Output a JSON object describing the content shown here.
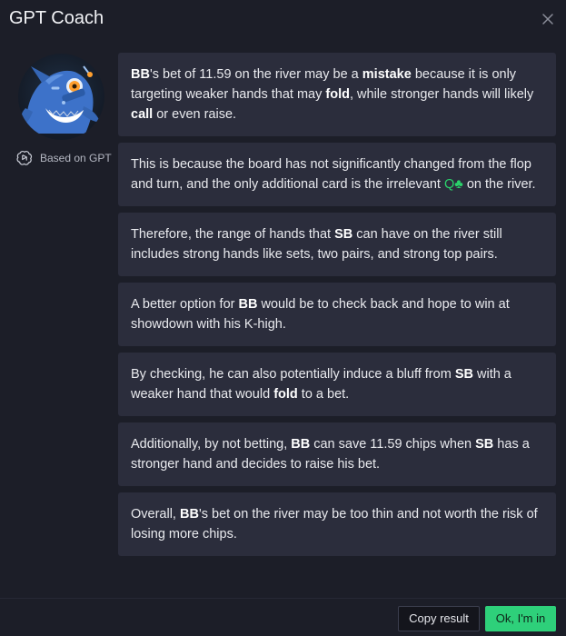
{
  "dialog": {
    "title": "GPT Coach",
    "close_icon": "close-icon"
  },
  "sidebar": {
    "avatar_icon": "shark-robot-avatar",
    "based_on_label": "Based on GPT",
    "gpt_icon": "openai-logo-icon"
  },
  "messages": [
    {
      "parts": [
        {
          "t": "BB",
          "b": true
        },
        {
          "t": "'s bet of 11.59 on the river may be a "
        },
        {
          "t": "mistake",
          "b": true
        },
        {
          "t": " because it is only targeting weaker hands that may "
        },
        {
          "t": "fold",
          "b": true
        },
        {
          "t": ", while stronger hands will likely "
        },
        {
          "t": "call",
          "b": true
        },
        {
          "t": " or even raise."
        }
      ]
    },
    {
      "parts": [
        {
          "t": "This is because the board has not significantly changed from the flop and turn, and the only additional card is the irrelevant "
        },
        {
          "t": "Q♣",
          "card": true
        },
        {
          "t": " on the river."
        }
      ]
    },
    {
      "parts": [
        {
          "t": "Therefore, the range of hands that "
        },
        {
          "t": "SB",
          "b": true
        },
        {
          "t": " can have on the river still includes strong hands like sets, two pairs, and strong top pairs."
        }
      ]
    },
    {
      "parts": [
        {
          "t": "A better option for "
        },
        {
          "t": "BB",
          "b": true
        },
        {
          "t": " would be to check back and hope to win at showdown with his K-high."
        }
      ]
    },
    {
      "parts": [
        {
          "t": "By checking, he can also potentially induce a bluff from "
        },
        {
          "t": "SB",
          "b": true
        },
        {
          "t": " with a weaker hand that would "
        },
        {
          "t": "fold",
          "b": true
        },
        {
          "t": " to a bet."
        }
      ]
    },
    {
      "parts": [
        {
          "t": "Additionally, by not betting, "
        },
        {
          "t": "BB",
          "b": true
        },
        {
          "t": " can save 11.59 chips when "
        },
        {
          "t": "SB",
          "b": true
        },
        {
          "t": " has a stronger hand and decides to raise his bet."
        }
      ]
    },
    {
      "parts": [
        {
          "t": "Overall, "
        },
        {
          "t": "BB",
          "b": true
        },
        {
          "t": "'s bet on the river may be too thin and not worth the risk of losing more chips."
        }
      ]
    }
  ],
  "footer": {
    "copy_label": "Copy result",
    "ok_label": "Ok, I'm in"
  },
  "colors": {
    "background": "#1c1e28",
    "message_bg": "#2b2d3c",
    "accent_green": "#2ed07a",
    "club_card": "#2bd36b"
  }
}
